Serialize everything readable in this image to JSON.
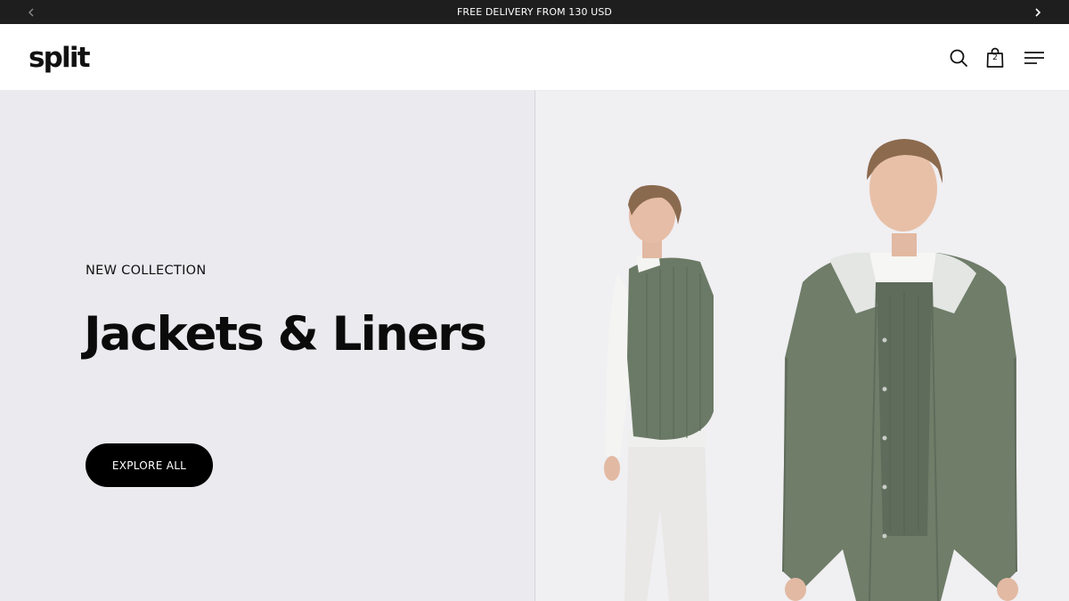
{
  "announcement": {
    "text": "FREE DELIVERY FROM 130 USD",
    "prev_icon": "chevron-left-icon",
    "next_icon": "chevron-right-icon"
  },
  "header": {
    "logo": "split",
    "search_icon": "search-icon",
    "cart_icon": "shopping-bag-icon",
    "cart_count": "2",
    "menu_icon": "hamburger-menu-icon"
  },
  "hero": {
    "eyebrow": "NEW COLLECTION",
    "title": "Jackets & Liners",
    "cta_label": "EXPLORE ALL",
    "image": "Two models: one in profile wearing a green quilted vest over a white shirt and white trousers, one facing forward in a green hooded rain jacket over a green vest",
    "colors": {
      "left_bg": "#ebeaee",
      "right_bg": "#f0eff2",
      "garment_green": "#6e7c68",
      "cta_bg": "#000000"
    }
  }
}
